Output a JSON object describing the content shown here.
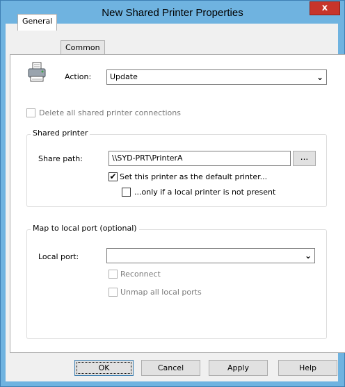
{
  "window": {
    "title": "New Shared Printer Properties",
    "close_glyph": "x"
  },
  "tabs": [
    {
      "label": "General",
      "active": true
    },
    {
      "label": "Common",
      "active": false
    }
  ],
  "general": {
    "action_label": "Action:",
    "action_value": "Update",
    "delete_all_label": "Delete all shared printer connections",
    "shared_printer_group": "Shared printer",
    "share_path_label": "Share path:",
    "share_path_value": "\\\\SYD-PRT\\PrinterA",
    "browse_label": "...",
    "set_default_label": "Set this printer as the default printer...",
    "only_if_label": "...only if a local printer is not present",
    "map_local_group": "Map to local port (optional)",
    "local_port_label": "Local port:",
    "local_port_value": "",
    "reconnect_label": "Reconnect",
    "unmap_label": "Unmap all local ports"
  },
  "checkbox_states": {
    "delete_all": false,
    "set_default": true,
    "only_if": false,
    "reconnect": false,
    "unmap": false
  },
  "buttons": {
    "ok": "OK",
    "cancel": "Cancel",
    "apply": "Apply",
    "help": "Help"
  },
  "icons": {
    "printer": "printer-icon",
    "dropdown": "chevron-down-icon",
    "check": "checkmark-icon"
  }
}
